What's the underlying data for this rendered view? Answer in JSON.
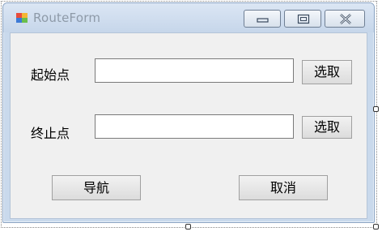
{
  "window": {
    "title": "RouteForm",
    "icon": "winforms-app-icon"
  },
  "caption_buttons": {
    "minimize_icon": "minimize-icon",
    "maximize_icon": "maximize-icon",
    "close_icon": "close-icon"
  },
  "form": {
    "start_label": "起始点",
    "start_value": "",
    "start_pick_label": "选取",
    "end_label": "终止点",
    "end_value": "",
    "end_pick_label": "选取",
    "navigate_label": "导航",
    "cancel_label": "取消"
  },
  "colors": {
    "title_text": "#8e9aa8",
    "client_bg": "#f0f0f0",
    "frame": "#c9d9ec"
  }
}
